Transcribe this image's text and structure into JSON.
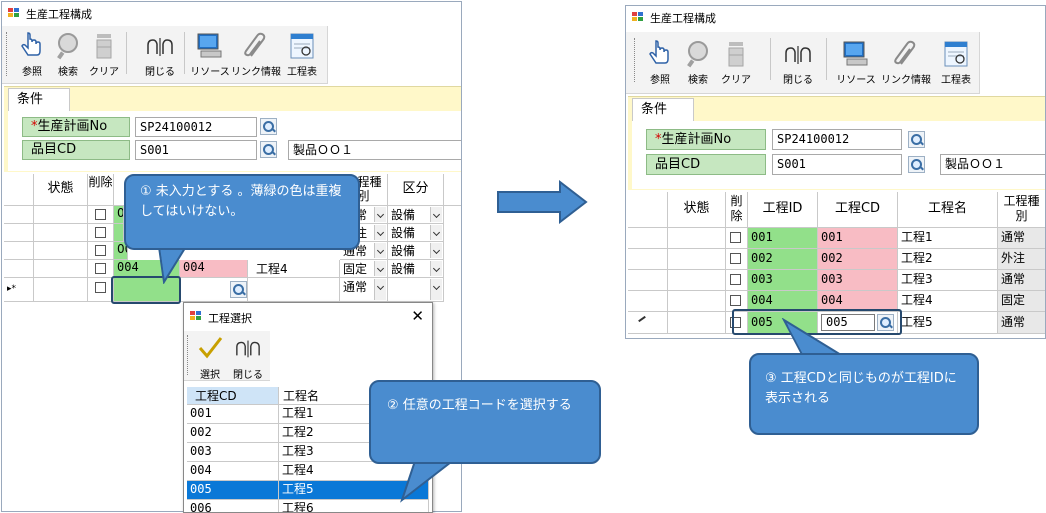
{
  "left_window": {
    "title": "生産工程構成",
    "toolbar": [
      {
        "label": "参照",
        "icon": "hand-pointer-icon"
      },
      {
        "label": "検索",
        "icon": "magnifier-icon"
      },
      {
        "label": "クリア",
        "icon": "trash-can-icon"
      },
      {
        "label": "閉じる",
        "icon": "close-hands-icon"
      },
      {
        "label": "リソース",
        "icon": "computer-icon"
      },
      {
        "label": "リンク情報",
        "icon": "paperclip-icon"
      },
      {
        "label": "工程表",
        "icon": "chart-sheet-icon"
      }
    ],
    "condition_tab": "条件",
    "fields": {
      "plan_no_label": "生産計画No",
      "plan_no_value": "SP24100012",
      "item_cd_label": "品目CD",
      "item_cd_value": "S001",
      "item_name": "製品ＯＯ１"
    },
    "grid": {
      "headers": {
        "status": "状態",
        "delete": "削除",
        "proc_kind": "工程種別",
        "category": "区分"
      },
      "rows": [
        {
          "id": "001",
          "kind": "通常",
          "cat": "設備"
        },
        {
          "id": "",
          "kind": "外注",
          "cat": "設備"
        },
        {
          "id": "00",
          "kind": "通常",
          "cat": "設備"
        },
        {
          "id": "004",
          "cd": "004",
          "name": "工程4",
          "kind": "固定",
          "cat": "設備"
        },
        {
          "marker": "▸*",
          "kind": "通常",
          "cat": ""
        }
      ]
    }
  },
  "dialog": {
    "title": "工程選択",
    "toolbar": [
      {
        "label": "選択",
        "icon": "checkmark-icon"
      },
      {
        "label": "閉じる",
        "icon": "close-hands-icon"
      }
    ],
    "headers": {
      "cd": "工程CD",
      "name": "工程名"
    },
    "rows": [
      {
        "cd": "001",
        "name": "工程1"
      },
      {
        "cd": "002",
        "name": "工程2"
      },
      {
        "cd": "003",
        "name": "工程3"
      },
      {
        "cd": "004",
        "name": "工程4"
      },
      {
        "cd": "005",
        "name": "工程5"
      },
      {
        "cd": "006",
        "name": "工程6"
      }
    ],
    "selected_index": 4
  },
  "right_window": {
    "title": "生産工程構成",
    "toolbar": [
      {
        "label": "参照",
        "icon": "hand-pointer-icon"
      },
      {
        "label": "検索",
        "icon": "magnifier-icon"
      },
      {
        "label": "クリア",
        "icon": "trash-can-icon"
      },
      {
        "label": "閉じる",
        "icon": "close-hands-icon"
      },
      {
        "label": "リソース",
        "icon": "computer-icon"
      },
      {
        "label": "リンク情報",
        "icon": "paperclip-icon"
      },
      {
        "label": "工程表",
        "icon": "chart-sheet-icon"
      }
    ],
    "condition_tab": "条件",
    "fields": {
      "plan_no_label": "生産計画No",
      "plan_no_value": "SP24100012",
      "item_cd_label": "品目CD",
      "item_cd_value": "S001",
      "item_name": "製品ＯＯ１"
    },
    "grid": {
      "headers": {
        "status": "状態",
        "delete": "削除",
        "proc_id": "工程ID",
        "proc_cd": "工程CD",
        "proc_name": "工程名",
        "proc_kind": "工程種別"
      },
      "rows": [
        {
          "id": "001",
          "cd": "001",
          "name": "工程1",
          "kind": "通常"
        },
        {
          "id": "002",
          "cd": "002",
          "name": "工程2",
          "kind": "外注"
        },
        {
          "id": "003",
          "cd": "003",
          "name": "工程3",
          "kind": "通常"
        },
        {
          "id": "004",
          "cd": "004",
          "name": "工程4",
          "kind": "固定"
        },
        {
          "id": "005",
          "cd": "005",
          "name": "工程5",
          "kind": "通常"
        }
      ]
    }
  },
  "callouts": {
    "c1": "① 未入力とする 。薄緑の色は重複してはいけない。",
    "c2": "② 任意の工程コードを選択する",
    "c3": "③ 工程CDと同じものが工程IDに表示される"
  },
  "colors": {
    "callout_fill": "#4a8ccf",
    "green_cell": "#92e08a",
    "pink_cell": "#f8bcc4",
    "selection": "#0a78d7",
    "arrow": "#4a8ccf"
  }
}
